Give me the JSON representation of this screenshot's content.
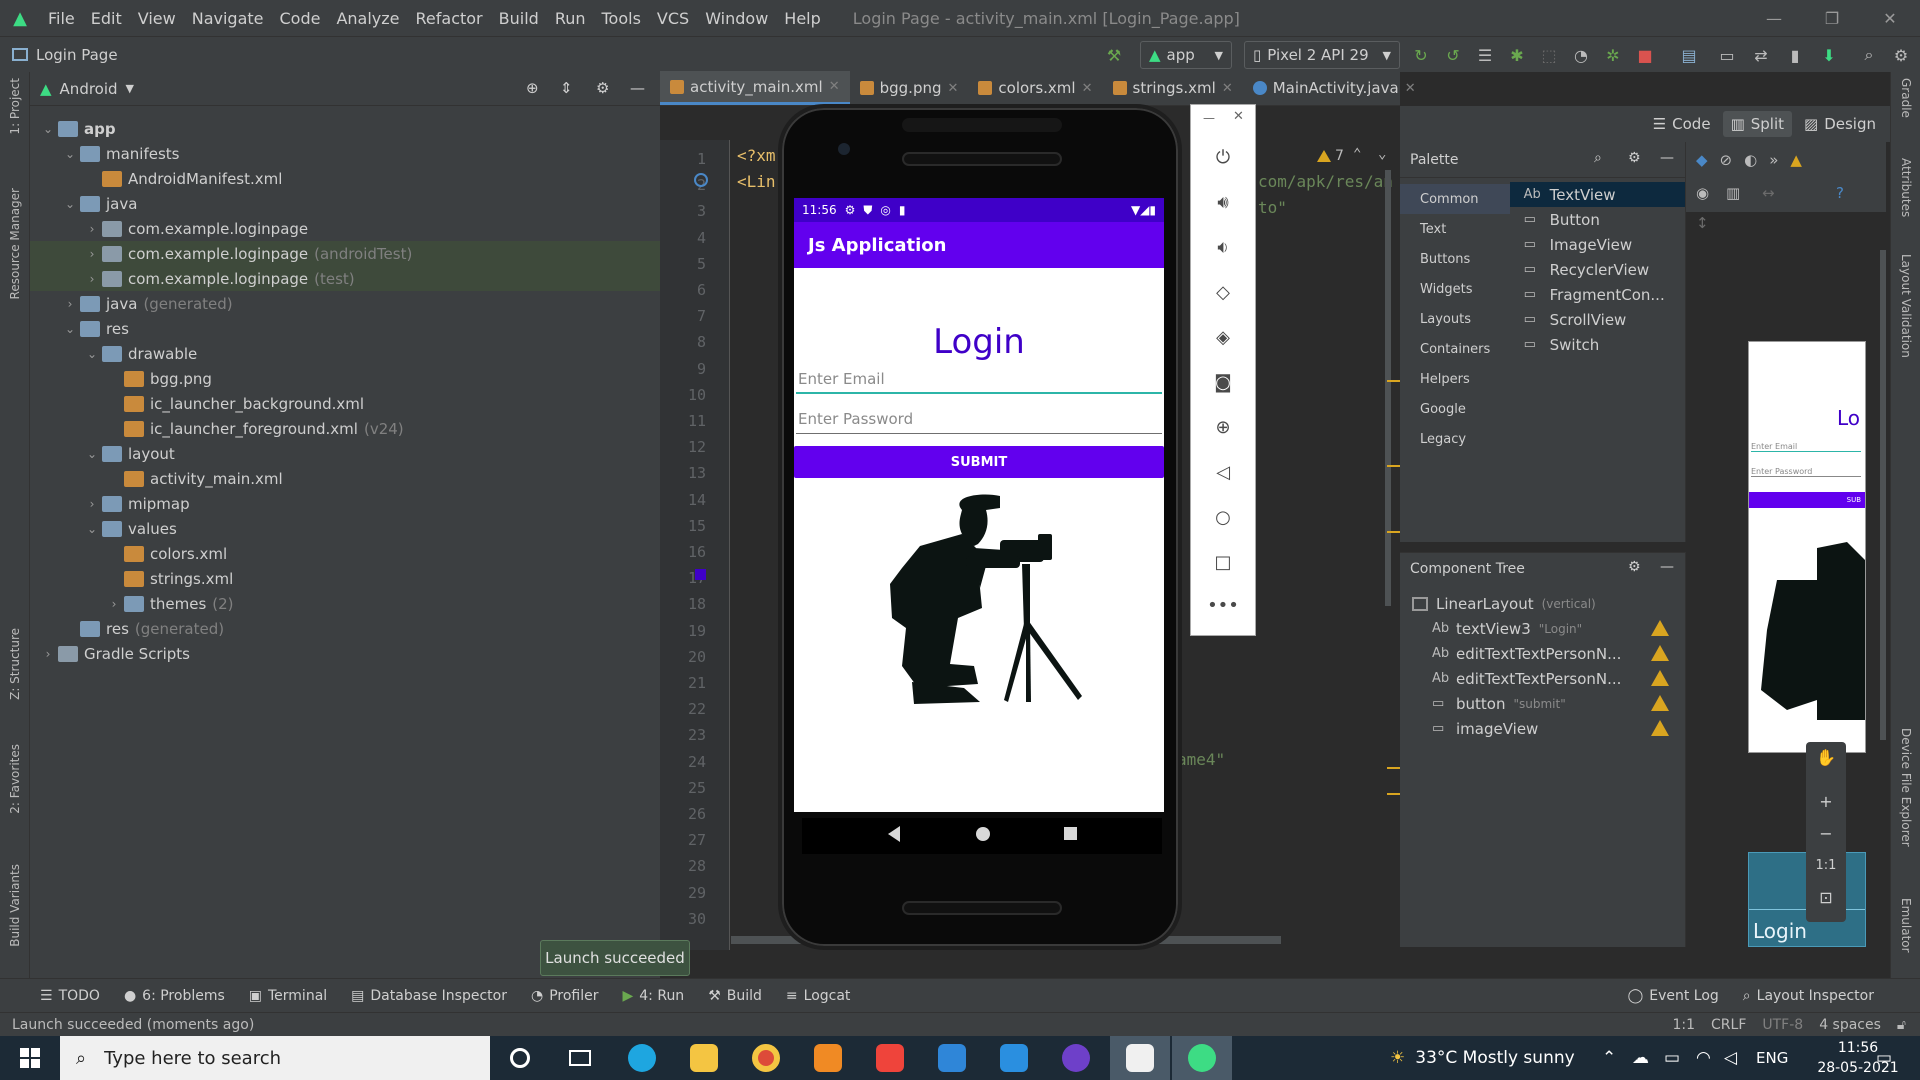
{
  "window": {
    "title": "Login Page - activity_main.xml [Login_Page.app]",
    "menu": [
      "File",
      "Edit",
      "View",
      "Navigate",
      "Code",
      "Analyze",
      "Refactor",
      "Build",
      "Run",
      "Tools",
      "VCS",
      "Window",
      "Help"
    ]
  },
  "nav": {
    "project": "Login Page",
    "run_config": "app",
    "device": "Pixel 2 API 29"
  },
  "project_panel": {
    "view_mode": "Android",
    "tree": [
      {
        "label": "app",
        "depth": 0,
        "expanded": true,
        "bold": true,
        "icon": "folder-icon"
      },
      {
        "label": "manifests",
        "depth": 1,
        "expanded": true,
        "icon": "folder-icon"
      },
      {
        "label": "AndroidManifest.xml",
        "depth": 2,
        "icon": "manifest-file-icon"
      },
      {
        "label": "java",
        "depth": 1,
        "expanded": true,
        "icon": "folder-icon"
      },
      {
        "label": "com.example.loginpage",
        "depth": 2,
        "collapsed": true,
        "icon": "package-icon"
      },
      {
        "label": "com.example.loginpage",
        "hint": "(androidTest)",
        "depth": 2,
        "collapsed": true,
        "icon": "package-icon",
        "highlight": true
      },
      {
        "label": "com.example.loginpage",
        "hint": "(test)",
        "depth": 2,
        "collapsed": true,
        "icon": "package-icon",
        "highlight": true
      },
      {
        "label": "java",
        "hint": "(generated)",
        "depth": 1,
        "collapsed": true,
        "icon": "folder-icon"
      },
      {
        "label": "res",
        "depth": 1,
        "expanded": true,
        "icon": "folder-icon"
      },
      {
        "label": "drawable",
        "depth": 2,
        "expanded": true,
        "icon": "folder-icon"
      },
      {
        "label": "bgg.png",
        "depth": 3,
        "icon": "image-file-icon"
      },
      {
        "label": "ic_launcher_background.xml",
        "depth": 3,
        "icon": "xml-file-icon"
      },
      {
        "label": "ic_launcher_foreground.xml",
        "hint": "(v24)",
        "depth": 3,
        "icon": "xml-file-icon"
      },
      {
        "label": "layout",
        "depth": 2,
        "expanded": true,
        "icon": "folder-icon"
      },
      {
        "label": "activity_main.xml",
        "depth": 3,
        "icon": "xml-file-icon"
      },
      {
        "label": "mipmap",
        "depth": 2,
        "collapsed": true,
        "icon": "folder-icon"
      },
      {
        "label": "values",
        "depth": 2,
        "expanded": true,
        "icon": "folder-icon"
      },
      {
        "label": "colors.xml",
        "depth": 3,
        "icon": "xml-file-icon"
      },
      {
        "label": "strings.xml",
        "depth": 3,
        "icon": "xml-file-icon"
      },
      {
        "label": "themes",
        "hint": "(2)",
        "depth": 3,
        "collapsed": true,
        "icon": "folder-icon"
      },
      {
        "label": "res",
        "hint": "(generated)",
        "depth": 1,
        "icon": "folder-icon"
      },
      {
        "label": "Gradle Scripts",
        "depth": 0,
        "collapsed": true,
        "icon": "gradle-icon"
      }
    ]
  },
  "editor_tabs": [
    "activity_main.xml",
    "bgg.png",
    "colors.xml",
    "strings.xml",
    "MainActivity.java"
  ],
  "code": {
    "line_numbers": [
      "1",
      "2",
      "3",
      "4",
      "5",
      "6",
      "7",
      "8",
      "9",
      "10",
      "11",
      "12",
      "13",
      "14",
      "15",
      "16",
      "17",
      "18",
      "19",
      "20",
      "21",
      "22",
      "23",
      "24",
      "25",
      "26",
      "27",
      "28",
      "29",
      "30"
    ],
    "line1": "<?xm",
    "line2": "<Lin",
    "frag_ns": "com/apk/res/an",
    "frag_auto": "to\"",
    "frag_name4": "ame4\"",
    "warnings": "7"
  },
  "emulator": {
    "status_time": "11:56",
    "app_title": "Js Application",
    "login_heading": "Login",
    "email_hint": "Enter Email",
    "password_hint": "Enter Password",
    "submit_label": "SUBMIT"
  },
  "view_modes": [
    "Code",
    "Split",
    "Design"
  ],
  "palette": {
    "title": "Palette",
    "categories": [
      "Common",
      "Text",
      "Buttons",
      "Widgets",
      "Layouts",
      "Containers",
      "Helpers",
      "Google",
      "Legacy"
    ],
    "items": [
      {
        "label": "TextView",
        "prefix": "Ab"
      },
      {
        "label": "Button"
      },
      {
        "label": "ImageView"
      },
      {
        "label": "RecyclerView"
      },
      {
        "label": "FragmentCon..."
      },
      {
        "label": "ScrollView"
      },
      {
        "label": "Switch"
      }
    ]
  },
  "component_tree": {
    "title": "Component Tree",
    "root": "LinearLayout",
    "root_hint": "(vertical)",
    "children": [
      {
        "label": "textView3",
        "hint": "\"Login\"",
        "prefix": "Ab"
      },
      {
        "label": "editTextTextPersonN...",
        "prefix": "Ab"
      },
      {
        "label": "editTextTextPersonN...",
        "prefix": "Ab"
      },
      {
        "label": "button",
        "hint": "\"submit\""
      },
      {
        "label": "imageView"
      }
    ]
  },
  "preview": {
    "heading_fragment": "Lo",
    "email_hint": "Enter Email",
    "password_hint": "Enter Password",
    "submit_fragment": "SUB",
    "blueprint_label": "Login",
    "zoom_ratio": "1:1"
  },
  "left_strip": [
    "1: Project",
    "Resource Manager",
    "Z: Structure",
    "2: Favorites",
    "Build Variants"
  ],
  "right_strip": [
    "Gradle",
    "Attributes",
    "Layout Validation",
    "Device File Explorer",
    "Emulator"
  ],
  "bottom_tools": [
    "TODO",
    "6: Problems",
    "Terminal",
    "Database Inspector",
    "Profiler",
    "4: Run",
    "Build",
    "Logcat"
  ],
  "bottom_right": [
    "Event Log",
    "Layout Inspector"
  ],
  "status": {
    "message": "Launch succeeded (moments ago)",
    "position": "1:1",
    "line_sep": "CRLF",
    "encoding": "UTF-8",
    "indent": "4 spaces"
  },
  "toast": "Launch succeeded",
  "taskbar": {
    "search_placeholder": "Type here to search",
    "weather": "33°C  Mostly sunny",
    "lang": "ENG",
    "time": "11:56",
    "date": "28-05-2021"
  },
  "colors": {
    "accent_purple": "#6200ee",
    "status_purple": "#3f00c8",
    "heading_purple": "#3f00c8",
    "ide_bg": "#2b2b2b",
    "panel_bg": "#3c3f41",
    "warning": "#d9a520"
  }
}
